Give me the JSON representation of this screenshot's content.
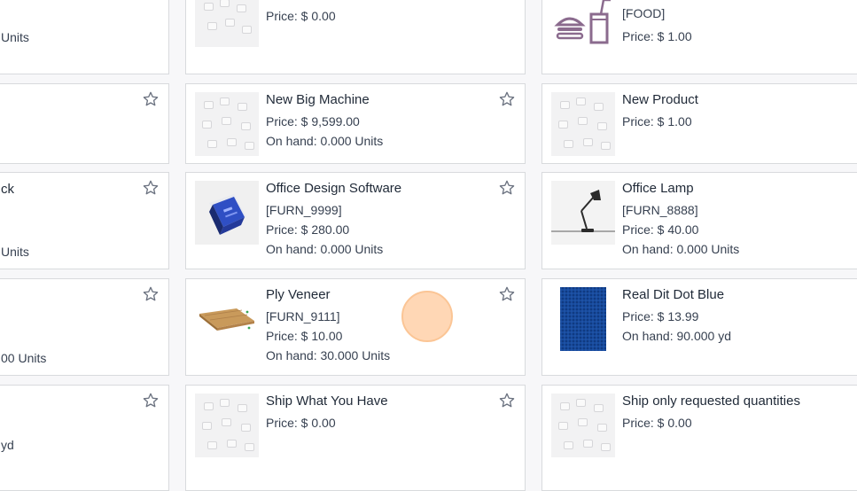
{
  "left_column": {
    "row1_units": "Units",
    "row3_name_fragment": "ck",
    "row3_units": "Units",
    "row4_units": "00 Units",
    "row5_units": "yd"
  },
  "products": [
    {
      "name": "",
      "ref": "",
      "price": "Price: $ 0.00",
      "onhand": "",
      "image": "placeholder-image",
      "favorite_icon": "star-icon"
    },
    {
      "name": "",
      "ref": "[FOOD]",
      "price": "Price: $ 1.00",
      "onhand": "",
      "image": "burger-drink-icon",
      "favorite_icon": ""
    },
    {
      "name": "New Big Machine",
      "ref": "",
      "price": "Price: $ 9,599.00",
      "onhand": "On hand: 0.000 Units",
      "image": "placeholder-image",
      "favorite_icon": "star-icon"
    },
    {
      "name": "New Product",
      "ref": "",
      "price": "Price: $ 1.00",
      "onhand": "",
      "image": "placeholder-image",
      "favorite_icon": "star-icon"
    },
    {
      "name": "Office Design Software",
      "ref": "[FURN_9999]",
      "price": "Price: $ 280.00",
      "onhand": "On hand: 0.000 Units",
      "image": "software-box-image",
      "favorite_icon": "star-icon"
    },
    {
      "name": "Office Lamp",
      "ref": "[FURN_8888]",
      "price": "Price: $ 40.00",
      "onhand": "On hand: 0.000 Units",
      "image": "desk-lamp-image",
      "favorite_icon": ""
    },
    {
      "name": "Ply Veneer",
      "ref": "[FURN_9111]",
      "price": "Price: $ 10.00",
      "onhand": "On hand: 30.000 Units",
      "image": "veneer-sheet-image",
      "favorite_icon": "star-icon"
    },
    {
      "name": "Real Dit Dot Blue",
      "ref": "",
      "price": "Price: $ 13.99",
      "onhand": "On hand: 90.000 yd",
      "image": "blue-fabric-image",
      "favorite_icon": ""
    },
    {
      "name": "Ship What You Have",
      "ref": "",
      "price": "Price: $ 0.00",
      "onhand": "",
      "image": "placeholder-image",
      "favorite_icon": "star-icon"
    },
    {
      "name": "Ship only requested quantities",
      "ref": "",
      "price": "Price: $ 0.00",
      "onhand": "",
      "image": "placeholder-image",
      "favorite_icon": ""
    }
  ],
  "colors": {
    "star": "#6b7280",
    "card_border": "#d8dadd",
    "accent_food_icon": "#8b6b8e",
    "cursor": "#ffd3ad"
  }
}
